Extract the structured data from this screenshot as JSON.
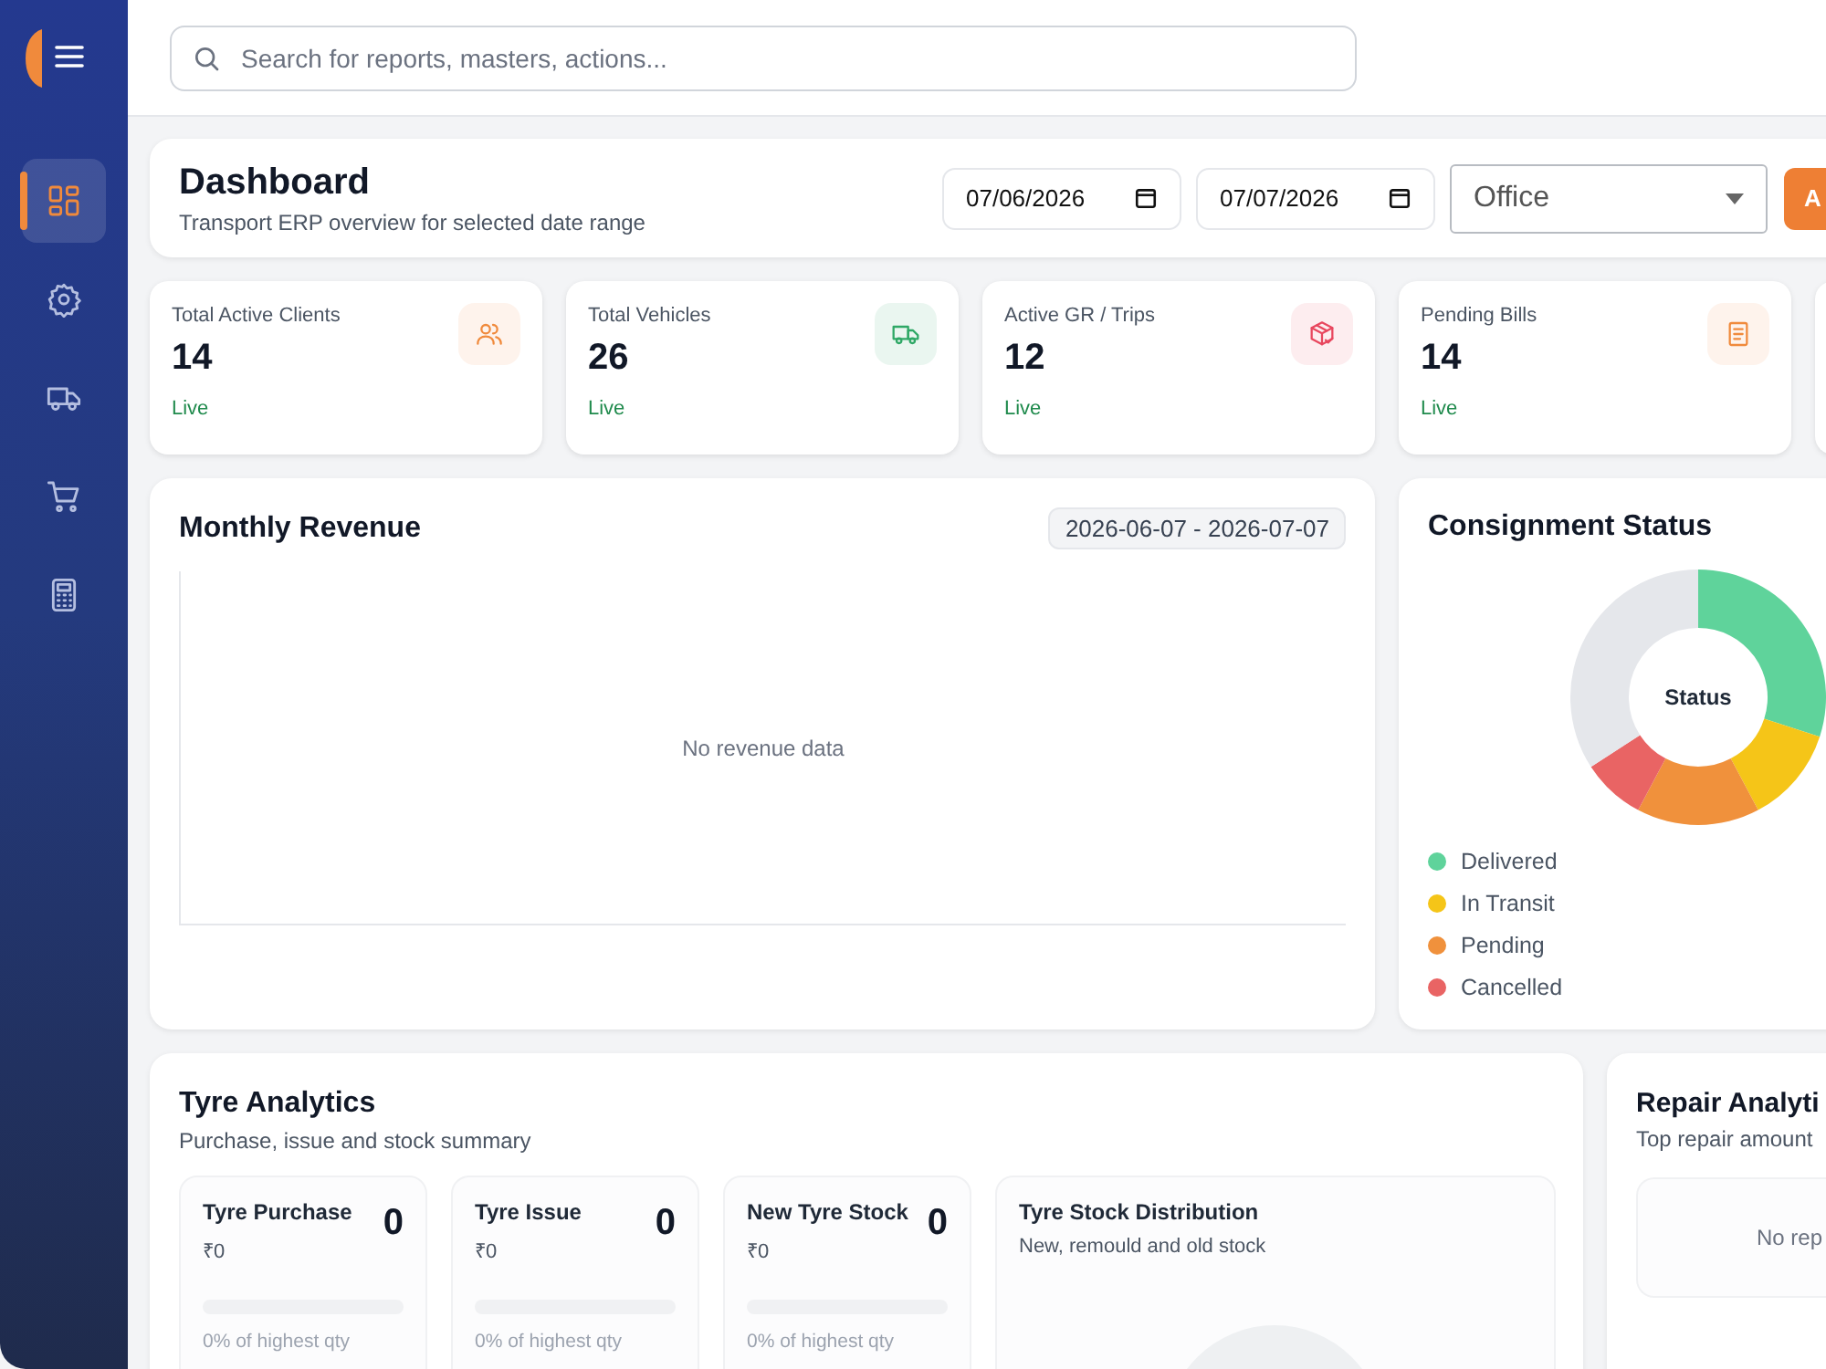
{
  "sidebar": {
    "items": [
      {
        "kind": "dashboard",
        "selected": true
      },
      {
        "kind": "settings",
        "selected": false
      },
      {
        "kind": "truck",
        "selected": false
      },
      {
        "kind": "cart",
        "selected": false
      },
      {
        "kind": "calculator",
        "selected": false
      }
    ]
  },
  "search": {
    "placeholder": "Search for reports, masters, actions..."
  },
  "header": {
    "title": "Dashboard",
    "subtitle": "Transport ERP overview for selected date range",
    "date_from": "07/06/2026",
    "date_to": "07/07/2026",
    "office": "Office",
    "action_button": "A"
  },
  "stats": [
    {
      "label": "Total Active Clients",
      "value": "14",
      "status": "Live",
      "kind": "users",
      "color": "#f08a3c"
    },
    {
      "label": "Total Vehicles",
      "value": "26",
      "status": "Live",
      "kind": "truck",
      "color": "#2fa866"
    },
    {
      "label": "Active GR / Trips",
      "value": "12",
      "status": "Live",
      "kind": "package",
      "color": "#e8475e"
    },
    {
      "label": "Pending Bills",
      "value": "14",
      "status": "Live",
      "kind": "document",
      "color": "#f08a3c"
    }
  ],
  "revenue": {
    "title": "Monthly Revenue",
    "range": "2026-06-07 - 2026-07-07",
    "empty": "No revenue data"
  },
  "consignment": {
    "title": "Consignment Status",
    "center": "Status",
    "legend": [
      {
        "label": "Delivered",
        "color": "#5fd39b"
      },
      {
        "label": "In Transit",
        "color": "#f5c518"
      },
      {
        "label": "Pending",
        "color": "#f0913c"
      },
      {
        "label": "Cancelled",
        "color": "#e96464"
      }
    ]
  },
  "tyre": {
    "title": "Tyre Analytics",
    "subtitle": "Purchase, issue and stock summary",
    "tiles": [
      {
        "title": "Tyre Purchase",
        "amount": "₹0",
        "count": "0",
        "level": 0,
        "note": "0% of highest qty"
      },
      {
        "title": "Tyre Issue",
        "amount": "₹0",
        "count": "0",
        "level": 0,
        "note": "0% of highest qty"
      },
      {
        "title": "New Tyre Stock",
        "amount": "₹0",
        "count": "0",
        "level": 0,
        "note": "0% of highest qty"
      }
    ],
    "distribution": {
      "title": "Tyre Stock Distribution",
      "subtitle": "New, remould and old stock"
    }
  },
  "repair": {
    "title": "Repair Analyti",
    "subtitle": "Top repair amount",
    "empty": "No rep"
  }
}
